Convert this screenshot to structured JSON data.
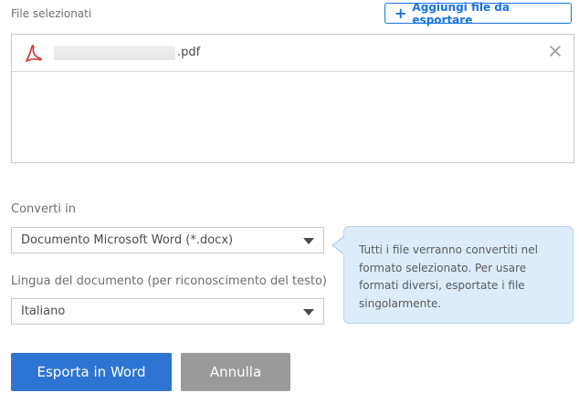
{
  "files": {
    "label": "File selezionati",
    "add_button_label": "Aggiungi file da esportare",
    "items": [
      {
        "extension": ".pdf",
        "icon": "pdf-icon"
      }
    ]
  },
  "convert": {
    "label": "Converti in",
    "selected": "Documento Microsoft Word (*.docx)"
  },
  "language": {
    "label": "Lingua del documento (per riconoscimento del testo)",
    "selected": "Italiano"
  },
  "tooltip": {
    "text": "Tutti i file verranno convertiti nel formato selezionato. Per usare formati diversi, esportate i file singolarmente."
  },
  "actions": {
    "export_label": "Esporta in Word",
    "cancel_label": "Annulla"
  },
  "colors": {
    "accent": "#1473e6",
    "primary_button": "#2d74d3",
    "secondary_button": "#9a9a9a",
    "tooltip_bg": "#dcecfb",
    "pdf_icon": "#d12f2f"
  }
}
